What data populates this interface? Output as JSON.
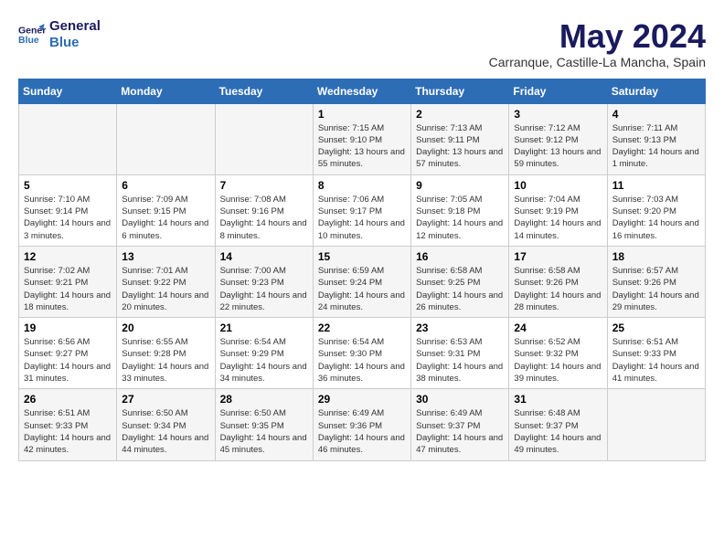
{
  "header": {
    "logo_line1": "General",
    "logo_line2": "Blue",
    "month_year": "May 2024",
    "location": "Carranque, Castille-La Mancha, Spain"
  },
  "weekdays": [
    "Sunday",
    "Monday",
    "Tuesday",
    "Wednesday",
    "Thursday",
    "Friday",
    "Saturday"
  ],
  "weeks": [
    [
      {
        "day": "",
        "sunrise": "",
        "sunset": "",
        "daylight": ""
      },
      {
        "day": "",
        "sunrise": "",
        "sunset": "",
        "daylight": ""
      },
      {
        "day": "",
        "sunrise": "",
        "sunset": "",
        "daylight": ""
      },
      {
        "day": "1",
        "sunrise": "Sunrise: 7:15 AM",
        "sunset": "Sunset: 9:10 PM",
        "daylight": "Daylight: 13 hours and 55 minutes."
      },
      {
        "day": "2",
        "sunrise": "Sunrise: 7:13 AM",
        "sunset": "Sunset: 9:11 PM",
        "daylight": "Daylight: 13 hours and 57 minutes."
      },
      {
        "day": "3",
        "sunrise": "Sunrise: 7:12 AM",
        "sunset": "Sunset: 9:12 PM",
        "daylight": "Daylight: 13 hours and 59 minutes."
      },
      {
        "day": "4",
        "sunrise": "Sunrise: 7:11 AM",
        "sunset": "Sunset: 9:13 PM",
        "daylight": "Daylight: 14 hours and 1 minute."
      }
    ],
    [
      {
        "day": "5",
        "sunrise": "Sunrise: 7:10 AM",
        "sunset": "Sunset: 9:14 PM",
        "daylight": "Daylight: 14 hours and 3 minutes."
      },
      {
        "day": "6",
        "sunrise": "Sunrise: 7:09 AM",
        "sunset": "Sunset: 9:15 PM",
        "daylight": "Daylight: 14 hours and 6 minutes."
      },
      {
        "day": "7",
        "sunrise": "Sunrise: 7:08 AM",
        "sunset": "Sunset: 9:16 PM",
        "daylight": "Daylight: 14 hours and 8 minutes."
      },
      {
        "day": "8",
        "sunrise": "Sunrise: 7:06 AM",
        "sunset": "Sunset: 9:17 PM",
        "daylight": "Daylight: 14 hours and 10 minutes."
      },
      {
        "day": "9",
        "sunrise": "Sunrise: 7:05 AM",
        "sunset": "Sunset: 9:18 PM",
        "daylight": "Daylight: 14 hours and 12 minutes."
      },
      {
        "day": "10",
        "sunrise": "Sunrise: 7:04 AM",
        "sunset": "Sunset: 9:19 PM",
        "daylight": "Daylight: 14 hours and 14 minutes."
      },
      {
        "day": "11",
        "sunrise": "Sunrise: 7:03 AM",
        "sunset": "Sunset: 9:20 PM",
        "daylight": "Daylight: 14 hours and 16 minutes."
      }
    ],
    [
      {
        "day": "12",
        "sunrise": "Sunrise: 7:02 AM",
        "sunset": "Sunset: 9:21 PM",
        "daylight": "Daylight: 14 hours and 18 minutes."
      },
      {
        "day": "13",
        "sunrise": "Sunrise: 7:01 AM",
        "sunset": "Sunset: 9:22 PM",
        "daylight": "Daylight: 14 hours and 20 minutes."
      },
      {
        "day": "14",
        "sunrise": "Sunrise: 7:00 AM",
        "sunset": "Sunset: 9:23 PM",
        "daylight": "Daylight: 14 hours and 22 minutes."
      },
      {
        "day": "15",
        "sunrise": "Sunrise: 6:59 AM",
        "sunset": "Sunset: 9:24 PM",
        "daylight": "Daylight: 14 hours and 24 minutes."
      },
      {
        "day": "16",
        "sunrise": "Sunrise: 6:58 AM",
        "sunset": "Sunset: 9:25 PM",
        "daylight": "Daylight: 14 hours and 26 minutes."
      },
      {
        "day": "17",
        "sunrise": "Sunrise: 6:58 AM",
        "sunset": "Sunset: 9:26 PM",
        "daylight": "Daylight: 14 hours and 28 minutes."
      },
      {
        "day": "18",
        "sunrise": "Sunrise: 6:57 AM",
        "sunset": "Sunset: 9:26 PM",
        "daylight": "Daylight: 14 hours and 29 minutes."
      }
    ],
    [
      {
        "day": "19",
        "sunrise": "Sunrise: 6:56 AM",
        "sunset": "Sunset: 9:27 PM",
        "daylight": "Daylight: 14 hours and 31 minutes."
      },
      {
        "day": "20",
        "sunrise": "Sunrise: 6:55 AM",
        "sunset": "Sunset: 9:28 PM",
        "daylight": "Daylight: 14 hours and 33 minutes."
      },
      {
        "day": "21",
        "sunrise": "Sunrise: 6:54 AM",
        "sunset": "Sunset: 9:29 PM",
        "daylight": "Daylight: 14 hours and 34 minutes."
      },
      {
        "day": "22",
        "sunrise": "Sunrise: 6:54 AM",
        "sunset": "Sunset: 9:30 PM",
        "daylight": "Daylight: 14 hours and 36 minutes."
      },
      {
        "day": "23",
        "sunrise": "Sunrise: 6:53 AM",
        "sunset": "Sunset: 9:31 PM",
        "daylight": "Daylight: 14 hours and 38 minutes."
      },
      {
        "day": "24",
        "sunrise": "Sunrise: 6:52 AM",
        "sunset": "Sunset: 9:32 PM",
        "daylight": "Daylight: 14 hours and 39 minutes."
      },
      {
        "day": "25",
        "sunrise": "Sunrise: 6:51 AM",
        "sunset": "Sunset: 9:33 PM",
        "daylight": "Daylight: 14 hours and 41 minutes."
      }
    ],
    [
      {
        "day": "26",
        "sunrise": "Sunrise: 6:51 AM",
        "sunset": "Sunset: 9:33 PM",
        "daylight": "Daylight: 14 hours and 42 minutes."
      },
      {
        "day": "27",
        "sunrise": "Sunrise: 6:50 AM",
        "sunset": "Sunset: 9:34 PM",
        "daylight": "Daylight: 14 hours and 44 minutes."
      },
      {
        "day": "28",
        "sunrise": "Sunrise: 6:50 AM",
        "sunset": "Sunset: 9:35 PM",
        "daylight": "Daylight: 14 hours and 45 minutes."
      },
      {
        "day": "29",
        "sunrise": "Sunrise: 6:49 AM",
        "sunset": "Sunset: 9:36 PM",
        "daylight": "Daylight: 14 hours and 46 minutes."
      },
      {
        "day": "30",
        "sunrise": "Sunrise: 6:49 AM",
        "sunset": "Sunset: 9:37 PM",
        "daylight": "Daylight: 14 hours and 47 minutes."
      },
      {
        "day": "31",
        "sunrise": "Sunrise: 6:48 AM",
        "sunset": "Sunset: 9:37 PM",
        "daylight": "Daylight: 14 hours and 49 minutes."
      },
      {
        "day": "",
        "sunrise": "",
        "sunset": "",
        "daylight": ""
      }
    ]
  ]
}
